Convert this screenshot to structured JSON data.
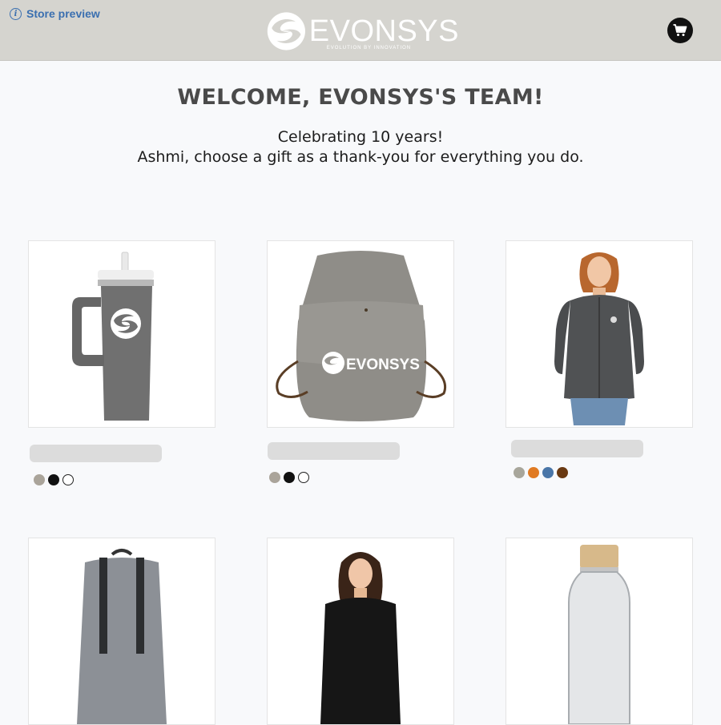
{
  "header": {
    "store_preview_label": "Store preview",
    "logo": {
      "name": "EVONSYS",
      "tagline": "EVOLUTION BY INNOVATION"
    },
    "cart_icon": "cart-icon"
  },
  "hero": {
    "title": "WELCOME, EVONSYS'S TEAM!",
    "line1": "Celebrating 10 years!",
    "line2": "Ashmi, choose a gift as a thank-you for everything you do."
  },
  "products": [
    {
      "image": "tumbler",
      "colors": [
        "#aaa49a",
        "#111111",
        "#ffffff"
      ]
    },
    {
      "image": "canvas-backpack",
      "logo_text": "EVONSYS",
      "colors": [
        "#aaa49a",
        "#111111",
        "#ffffff"
      ]
    },
    {
      "image": "fleece-jacket",
      "colors": [
        "#a8a69b",
        "#e07a22",
        "#4a76a8",
        "#6a3a12"
      ]
    },
    {
      "image": "gray-backpack"
    },
    {
      "image": "black-shirt"
    },
    {
      "image": "water-bottle"
    }
  ]
}
